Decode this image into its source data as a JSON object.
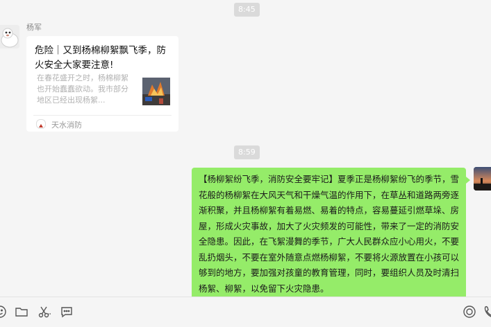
{
  "chat": {
    "timestamps": [
      "8:45",
      "8:59"
    ],
    "incoming": {
      "sender": "杨军",
      "card": {
        "title": "危险｜又到杨棉柳絮飘飞季，防火安全大家要注意!",
        "description": "在春花盛开之时，杨棉柳絮也开始蠢蠢欲动。我市部分地区已经出现杨絮...",
        "source": "天水消防"
      }
    },
    "outgoing": {
      "text": "【杨柳絮纷飞季，消防安全要牢记】夏季正是杨柳絮纷飞的季节，雪花般的杨柳絮在大风天气和干燥气温的作用下，在草丛和道路两旁逐渐积聚，并且杨柳絮有着易燃、易着的特点，容易蔓延引燃草垛、房屋，形成火灾事故，加大了火灾频发的可能性，带来了一定的消防安全隐患。因此，在飞絮漫舞的季节，广大人民群众应小心用火，不要乱扔烟头，不要在室外随意点燃杨柳絮，不要将火源放置在小孩可以够到的地方，要加强对孩童的教育管理，同时，要组织人员及时清扫杨絮、柳絮，以免留下火灾隐患。"
    }
  },
  "toolbar": {
    "icons": [
      "emoji-icon",
      "folder-icon",
      "scissors-icon",
      "chat-bubble-icon",
      "voice-call-icon",
      "video-call-icon"
    ]
  },
  "colors": {
    "background": "#f5f5f5",
    "outgoing_bubble": "#95ec69",
    "card": "#ffffff",
    "time_pill": "#dadada"
  }
}
